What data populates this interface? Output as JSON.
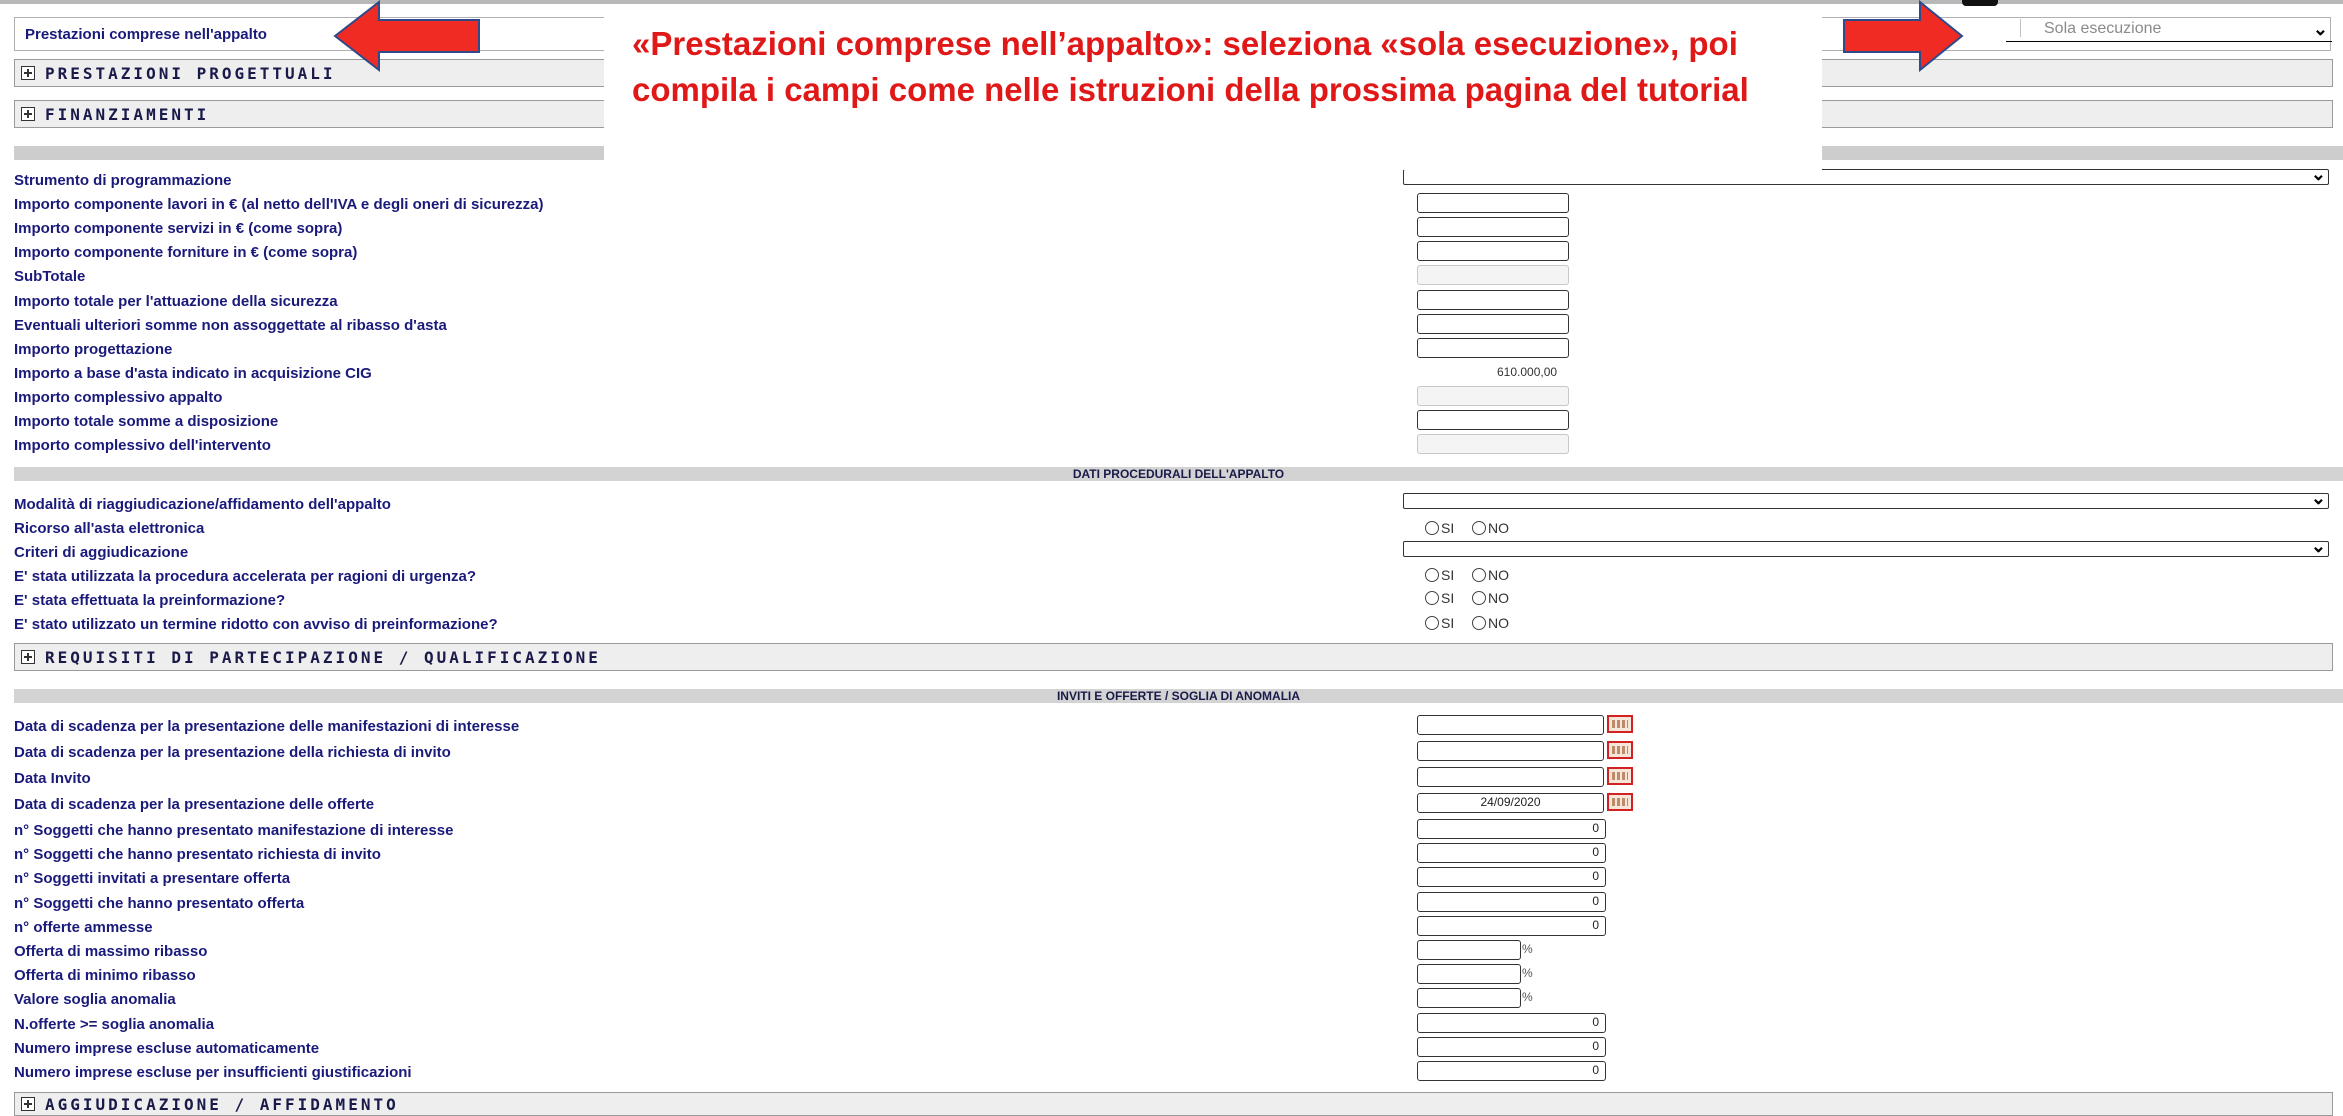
{
  "top": {
    "label": "Prestazioni comprese nell'appalto",
    "select_value": "Sola esecuzione"
  },
  "sections": {
    "progettuali": "PRESTAZIONI PROGETTUALI",
    "finanziamenti": "FINANZIAMENTI",
    "requisiti": "REQUISITI DI PARTECIPAZIONE / QUALIFICAZIONE",
    "aggiudicazione": "AGGIUDICAZIONE / AFFIDAMENTO"
  },
  "callout": "«Prestazioni comprese nell’appalto»: seleziona «sola esecuzione», poi compila i campi come nelle istruzioni della prossima pagina del tutorial",
  "importi": {
    "strumento": "Strumento di programmazione",
    "lavori": "Importo componente lavori in € (al netto dell'IVA e degli oneri di sicurezza)",
    "servizi": "Importo componente servizi in € (come sopra)",
    "forniture": "Importo componente forniture in € (come sopra)",
    "subtotale": "SubTotale",
    "sicurezza": "Importo totale per l'attuazione della sicurezza",
    "ulteriori": "Eventuali ulteriori somme non assoggettate al ribasso d'asta",
    "progettazione": "Importo progettazione",
    "base_asta": "Importo a base d'asta indicato in acquisizione CIG",
    "base_asta_value": "610.000,00",
    "complessivo_appalto": "Importo complessivo appalto",
    "somme_disposizione": "Importo totale somme a disposizione",
    "complessivo_intervento": "Importo complessivo dell'intervento"
  },
  "procedurali": {
    "band": "DATI PROCEDURALI DELL'APPALTO",
    "modalita": "Modalità di riaggiudicazione/affidamento dell'appalto",
    "asta_elettronica": "Ricorso all'asta elettronica",
    "criteri": "Criteri di aggiudicazione",
    "urgenza": "E' stata utilizzata la procedura accelerata per ragioni di urgenza?",
    "preinformazione": "E' stata effettuata la preinformazione?",
    "termine_ridotto": "E' stato utilizzato un termine ridotto con avviso di preinformazione?",
    "si": "SI",
    "no": "NO"
  },
  "inviti": {
    "band": "INVITI E OFFERTE / SOGLIA DI ANOMALIA",
    "scad_manifestazioni": "Data di scadenza per la presentazione delle manifestazioni di interesse",
    "scad_richiesta": "Data di scadenza per la presentazione della richiesta di invito",
    "data_invito": "Data Invito",
    "scad_offerte": "Data di scadenza per la presentazione delle offerte",
    "scad_offerte_value": "24/09/2020",
    "n_manifestazione": "n° Soggetti che hanno presentato manifestazione di interesse",
    "n_richiesta": "n° Soggetti che hanno presentato richiesta di invito",
    "n_invitati": "n° Soggetti invitati a presentare offerta",
    "n_offerta": "n° Soggetti che hanno presentato offerta",
    "n_ammesse": "n° offerte ammesse",
    "max_ribasso": "Offerta di massimo ribasso",
    "min_ribasso": "Offerta di minimo ribasso",
    "soglia": "Valore soglia anomalia",
    "n_soglia": "N.offerte >= soglia anomalia",
    "escluse_auto": "Numero imprese escluse automaticamente",
    "escluse_giust": "Numero imprese escluse per insufficienti giustificazioni",
    "zero": "0",
    "pct": "%"
  },
  "colors": {
    "label": "#1a1a7a",
    "callout": "#e01818",
    "arrow": "#ef2b24"
  }
}
